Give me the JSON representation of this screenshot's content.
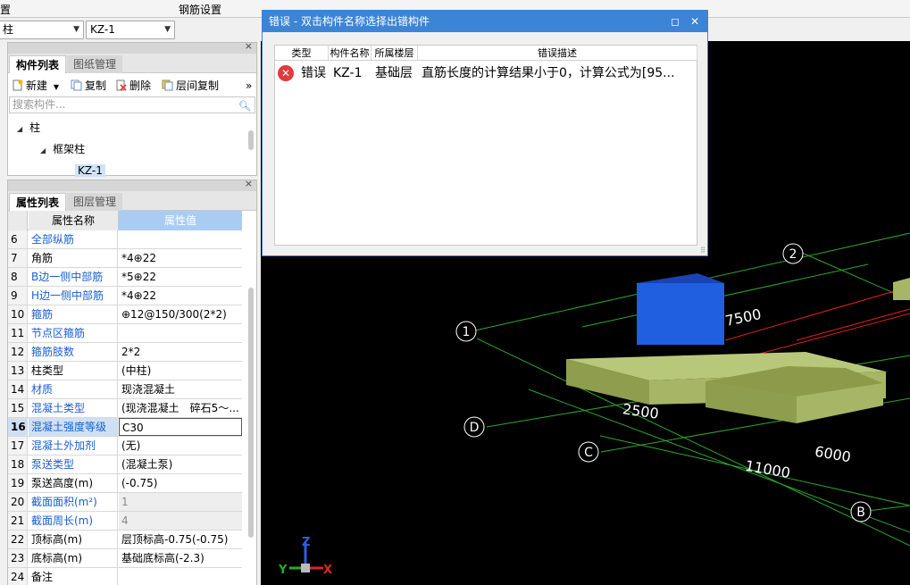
{
  "top": {
    "left_text": "置",
    "right_text": "钢筋设置"
  },
  "dropdowns": {
    "category": "柱",
    "component": "KZ-1"
  },
  "component_panel": {
    "tabs": [
      "构件列表",
      "图纸管理"
    ],
    "toolbar": {
      "new": "新建",
      "copy": "复制",
      "delete": "删除",
      "floor_copy": "层间复制"
    },
    "search_placeholder": "搜索构件...",
    "tree": {
      "root": "柱",
      "child": "框架柱",
      "leaf": "KZ-1"
    }
  },
  "property_panel": {
    "tabs": [
      "属性列表",
      "图层管理"
    ],
    "headers": {
      "name": "属性名称",
      "value": "属性值"
    },
    "rows": [
      {
        "num": "6",
        "name": "全部纵筋",
        "value": "",
        "blue": true
      },
      {
        "num": "7",
        "name": "角筋",
        "value": "*4⊕22",
        "blue": false
      },
      {
        "num": "8",
        "name": "B边一侧中部筋",
        "value": "*5⊕22",
        "blue": true
      },
      {
        "num": "9",
        "name": "H边一侧中部筋",
        "value": "*4⊕22",
        "blue": true
      },
      {
        "num": "10",
        "name": "箍筋",
        "value": "⊕12@150/300(2*2)",
        "blue": true
      },
      {
        "num": "11",
        "name": "节点区箍筋",
        "value": "",
        "blue": true
      },
      {
        "num": "12",
        "name": "箍筋肢数",
        "value": "2*2",
        "blue": true
      },
      {
        "num": "13",
        "name": "柱类型",
        "value": "(中柱)",
        "blue": false
      },
      {
        "num": "14",
        "name": "材质",
        "value": "现浇混凝土",
        "blue": true
      },
      {
        "num": "15",
        "name": "混凝土类型",
        "value": "(现浇混凝土　碎石5～...",
        "blue": true
      },
      {
        "num": "16",
        "name": "混凝土强度等级",
        "value": "C30",
        "blue": true,
        "selected": true
      },
      {
        "num": "17",
        "name": "混凝土外加剂",
        "value": "(无)",
        "blue": true
      },
      {
        "num": "18",
        "name": "泵送类型",
        "value": "(混凝土泵)",
        "blue": true
      },
      {
        "num": "19",
        "name": "泵送高度(m)",
        "value": "(-0.75)",
        "blue": false
      },
      {
        "num": "20",
        "name": "截面面积(m²)",
        "value": "1",
        "blue": true,
        "disabled": true
      },
      {
        "num": "21",
        "name": "截面周长(m)",
        "value": "4",
        "blue": true,
        "disabled": true
      },
      {
        "num": "22",
        "name": "顶标高(m)",
        "value": "层顶标高-0.75(-0.75)",
        "blue": false
      },
      {
        "num": "23",
        "name": "底标高(m)",
        "value": "基础底标高(-2.3)",
        "blue": false
      },
      {
        "num": "24",
        "name": "备注",
        "value": "",
        "blue": false
      }
    ]
  },
  "dialog": {
    "title": "错误 - 双击构件名称选择出错构件",
    "columns": [
      "类型",
      "构件名称",
      "所属楼层",
      "错误描述"
    ],
    "row": {
      "type": "错误",
      "name": "KZ-1",
      "floor": "基础层",
      "desc": "直筋长度的计算结果小于0，计算公式为[95..."
    }
  },
  "viewport": {
    "axis_labels": [
      "1",
      "2",
      "D",
      "C",
      "B"
    ],
    "dimensions": [
      "7500",
      "2500",
      "6000",
      "11000"
    ],
    "axes": [
      "Z",
      "Y",
      "X"
    ]
  },
  "colors": {
    "accent": "#3c84d6",
    "column": "#1f5fe0",
    "footing": "#a7b566"
  }
}
